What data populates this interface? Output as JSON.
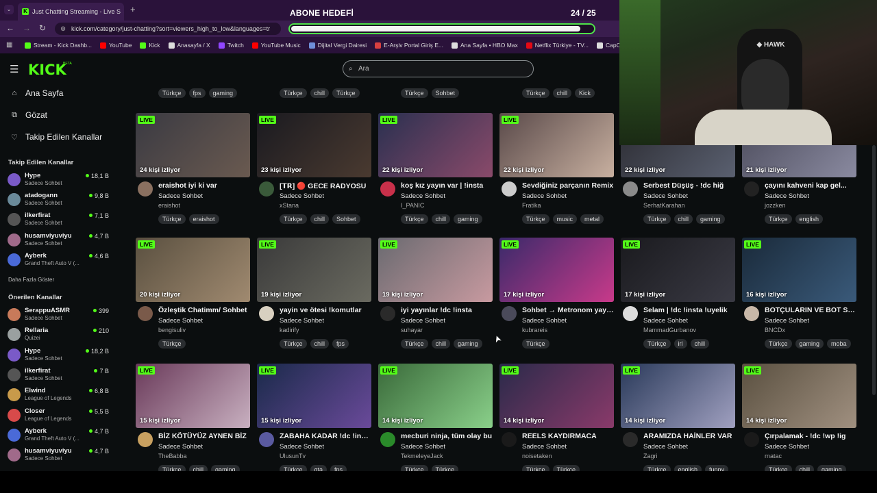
{
  "browser": {
    "tab_title": "Just Chatting Streaming - Live S",
    "tab_close": "×",
    "new_tab": "+",
    "url": "kick.com/category/just-chatting?sort=viewers_high_to_low&languages=tr",
    "bookmarks": [
      {
        "label": "Stream - Kick Dashb...",
        "color": "#53fc18"
      },
      {
        "label": "YouTube",
        "color": "#ff0000"
      },
      {
        "label": "Kick",
        "color": "#53fc18"
      },
      {
        "label": "Anasayfa / X",
        "color": "#dddddd"
      },
      {
        "label": "Twitch",
        "color": "#9146ff"
      },
      {
        "label": "YouTube Music",
        "color": "#ff0000"
      },
      {
        "label": "Dijital Vergi Dairesi",
        "color": "#6f8fd8"
      },
      {
        "label": "E-Arşiv Portal Giriş E...",
        "color": "#d84040"
      },
      {
        "label": "Ana Sayfa • HBO Max",
        "color": "#dddddd"
      },
      {
        "label": "Netflix Türkiye - TV...",
        "color": "#e50914"
      },
      {
        "label": "CapCut | Hepsi i",
        "color": "#dddddd"
      }
    ]
  },
  "overlay": {
    "goal_title": "ABONE HEDEFİ",
    "goal_count": "24 / 25",
    "goal_progress": 0.96
  },
  "header": {
    "logo": "KICK",
    "logo_badge": "BETA",
    "search_placeholder": "Ara"
  },
  "sidebar": {
    "nav": [
      {
        "label": "Ana Sayfa",
        "icon": "home-icon",
        "glyph": "⌂"
      },
      {
        "label": "Gözat",
        "icon": "browse-icon",
        "glyph": "⧉"
      },
      {
        "label": "Takip Edilen Kanallar",
        "icon": "heart-icon",
        "glyph": "♡"
      }
    ],
    "followed_title": "Takip Edilen Kanallar",
    "followed": [
      {
        "name": "Hype",
        "category": "Sadece Sohbet",
        "viewers": "18,1 B",
        "color": "#7a5ac8"
      },
      {
        "name": "atadogann",
        "category": "Sadece Sohbet",
        "viewers": "9,8 B",
        "color": "#6a8a9a"
      },
      {
        "name": "ilkerfirat",
        "category": "Sadece Sohbet",
        "viewers": "7,1 B",
        "color": "#555555"
      },
      {
        "name": "husamviyuviyu",
        "category": "Sadece Sohbet",
        "viewers": "4,7 B",
        "color": "#a06a8a"
      },
      {
        "name": "Ayberk",
        "category": "Grand Theft Auto V (...",
        "viewers": "4,6 B",
        "color": "#4a6ad8"
      }
    ],
    "show_more": "Daha Fazla Göster",
    "recommended_title": "Önerilen Kanallar",
    "recommended": [
      {
        "name": "SerappuASMR",
        "category": "Sadece Sohbet",
        "viewers": "399",
        "color": "#c87a5a"
      },
      {
        "name": "Rellaria",
        "category": "Quizei",
        "viewers": "210",
        "color": "#9aa0a0"
      },
      {
        "name": "Hype",
        "category": "Sadece Sohbet",
        "viewers": "18,2 B",
        "color": "#7a5ac8"
      },
      {
        "name": "ilkerfirat",
        "category": "Sadece Sohbet",
        "viewers": "7 B",
        "color": "#555555"
      },
      {
        "name": "Elwind",
        "category": "League of Legends",
        "viewers": "6,8 B",
        "color": "#c89a4a"
      },
      {
        "name": "Closer",
        "category": "League of Legends",
        "viewers": "5,5 B",
        "color": "#d84a4a"
      },
      {
        "name": "Ayberk",
        "category": "Grand Theft Auto V (...",
        "viewers": "4,7 B",
        "color": "#4a6ad8"
      },
      {
        "name": "husamviyuviyu",
        "category": "Sadece Sohbet",
        "viewers": "4,7 B",
        "color": "#a06a8a"
      }
    ]
  },
  "top_tags": [
    [
      "Türkçe",
      "fps",
      "gaming"
    ],
    [
      "Türkçe",
      "chill",
      "Türkçe"
    ],
    [
      "Türkçe",
      "Sohbet"
    ],
    [
      "Türkçe",
      "chill",
      "Kick"
    ]
  ],
  "live_label": "LIVE",
  "streams": [
    {
      "viewers": "24 kişi izliyor",
      "title": "eraishot iyi ki var",
      "category": "Sadece Sohbet",
      "channel": "eraishot",
      "tags": [
        "Türkçe",
        "eraishot"
      ],
      "thumb": [
        "#3a3a42",
        "#6a5a50"
      ],
      "avatar": "#8a7060"
    },
    {
      "viewers": "23 kişi izliyor",
      "title": "[𝗧𝗥] 🔴 GECE RADYOSU",
      "category": "Sadece Sohbet",
      "channel": "xStana",
      "tags": [
        "Türkçe",
        "chill",
        "Sohbet"
      ],
      "thumb": [
        "#1a1a20",
        "#4a3a30"
      ],
      "avatar": "#3a5a3a"
    },
    {
      "viewers": "22 kişi izliyor",
      "title": "koş kız yayın var | !insta",
      "category": "Sadece Sohbet",
      "channel": "I_PANIC",
      "tags": [
        "Türkçe",
        "chill",
        "gaming"
      ],
      "thumb": [
        "#2a3050",
        "#8a4a6a"
      ],
      "avatar": "#c8304a"
    },
    {
      "viewers": "22 kişi izliyor",
      "title": "Sevdiğiniz parçanın Remix",
      "category": "Sadece Sohbet",
      "channel": "Fratika",
      "tags": [
        "Türkçe",
        "music",
        "metal"
      ],
      "thumb": [
        "#5a4a4a",
        "#c8b0a0"
      ],
      "avatar": "#cccccc"
    },
    {
      "viewers": "22 kişi izliyor",
      "title": "Serbest Düşüş - !dc hiğ",
      "category": "Sadece Sohbet",
      "channel": "SerhatKarahan",
      "tags": [
        "Türkçe",
        "chill",
        "gaming"
      ],
      "thumb": [
        "#2a2a30",
        "#5a6070"
      ],
      "avatar": "#8a8a8a"
    },
    {
      "viewers": "21 kişi izliyor",
      "title": "çayını kahveni kap gel...",
      "category": "Sadece Sohbet",
      "channel": "jozzken",
      "tags": [
        "Türkçe",
        "english"
      ],
      "thumb": [
        "#4a4a5a",
        "#8a8aa0"
      ],
      "avatar": "#222222"
    },
    {
      "viewers": "20 kişi izliyor",
      "title": "Özleştik Chatimm/ Sohbet",
      "category": "Sadece Sohbet",
      "channel": "bengisuliv",
      "tags": [
        "Türkçe"
      ],
      "thumb": [
        "#5a5040",
        "#a08a70"
      ],
      "avatar": "#7a5a4a"
    },
    {
      "viewers": "19 kişi izliyor",
      "title": "yayin ve ötesi !komutlar",
      "category": "Sadece Sohbet",
      "channel": "kadirify",
      "tags": [
        "Türkçe",
        "chill",
        "fps"
      ],
      "thumb": [
        "#3a3a3a",
        "#6a6a60"
      ],
      "avatar": "#d8d0c0"
    },
    {
      "viewers": "19 kişi izliyor",
      "title": "iyi yayınlar !dc !insta",
      "category": "Sadece Sohbet",
      "channel": "suhayar",
      "tags": [
        "Türkçe",
        "chill",
        "gaming"
      ],
      "thumb": [
        "#6a6a70",
        "#c89aa0"
      ],
      "avatar": "#2a2a2a"
    },
    {
      "viewers": "17 kişi izliyor",
      "title": "Sohbet → Metronom yayını",
      "category": "Sadece Sohbet",
      "channel": "kubrareis",
      "tags": [
        "Türkçe"
      ],
      "thumb": [
        "#3a2a6a",
        "#c83a8a"
      ],
      "avatar": "#4a4a5a"
    },
    {
      "viewers": "17 kişi izliyor",
      "title": "Selam | !dc !insta !uyelik",
      "category": "Sadece Sohbet",
      "channel": "MammadGurbanov",
      "tags": [
        "Türkçe",
        "irl",
        "chill"
      ],
      "thumb": [
        "#1a1a1e",
        "#3a3a44"
      ],
      "avatar": "#dddddd"
    },
    {
      "viewers": "16 kişi izliyor",
      "title": "BOTÇULARIN VE BOT SAYIYO",
      "category": "Sadece Sohbet",
      "channel": "BNCDx",
      "tags": [
        "Türkçe",
        "gaming",
        "moba"
      ],
      "thumb": [
        "#1a2a3a",
        "#3a5a7a"
      ],
      "avatar": "#c8b8a8"
    },
    {
      "viewers": "15 kişi izliyor",
      "title": "BİZ KÖTÜYÜZ AYNEN BİZ",
      "category": "Sadece Sohbet",
      "channel": "TheBabba",
      "tags": [
        "Türkçe",
        "chill",
        "gaming"
      ],
      "thumb": [
        "#6a3a5a",
        "#c8b0c0"
      ],
      "avatar": "#c8a060"
    },
    {
      "viewers": "15 kişi izliyor",
      "title": "ZABAHA KADAR !dc !insta",
      "category": "Sadece Sohbet",
      "channel": "UlusunTv",
      "tags": [
        "Türkçe",
        "gta",
        "fps"
      ],
      "thumb": [
        "#1a2a4a",
        "#6a4a9a"
      ],
      "avatar": "#5a5aa0"
    },
    {
      "viewers": "14 kişi izliyor",
      "title": "mecburi ninja, tüm olay bu",
      "category": "Sadece Sohbet",
      "channel": "TekmeleyeJack",
      "tags": [
        "Türkçe",
        "Türkçe"
      ],
      "thumb": [
        "#3a6a3a",
        "#8ad08a"
      ],
      "avatar": "#2a8a2a"
    },
    {
      "viewers": "14 kişi izliyor",
      "title": "REELS KAYDIRMACA",
      "category": "Sadece Sohbet",
      "channel": "noisetaken",
      "tags": [
        "Türkçe",
        "Türkçe"
      ],
      "thumb": [
        "#2a2a4a",
        "#8a3a6a"
      ],
      "avatar": "#1a1a1a"
    },
    {
      "viewers": "14 kişi izliyor",
      "title": "ARAMIZDA HAİNLER VAR",
      "category": "Sadece Sohbet",
      "channel": "Zagri",
      "tags": [
        "Türkçe",
        "english",
        "funny"
      ],
      "thumb": [
        "#2a3a5a",
        "#a0a0c0"
      ],
      "avatar": "#2a2a2a"
    },
    {
      "viewers": "14 kişi izliyor",
      "title": "Çırpalamak - !dc !wp !ig",
      "category": "Sadece Sohbet",
      "channel": "rnatac",
      "tags": [
        "Türkçe",
        "chill",
        "gaming"
      ],
      "thumb": [
        "#5a5040",
        "#a09080"
      ],
      "avatar": "#1a1a1a"
    }
  ]
}
